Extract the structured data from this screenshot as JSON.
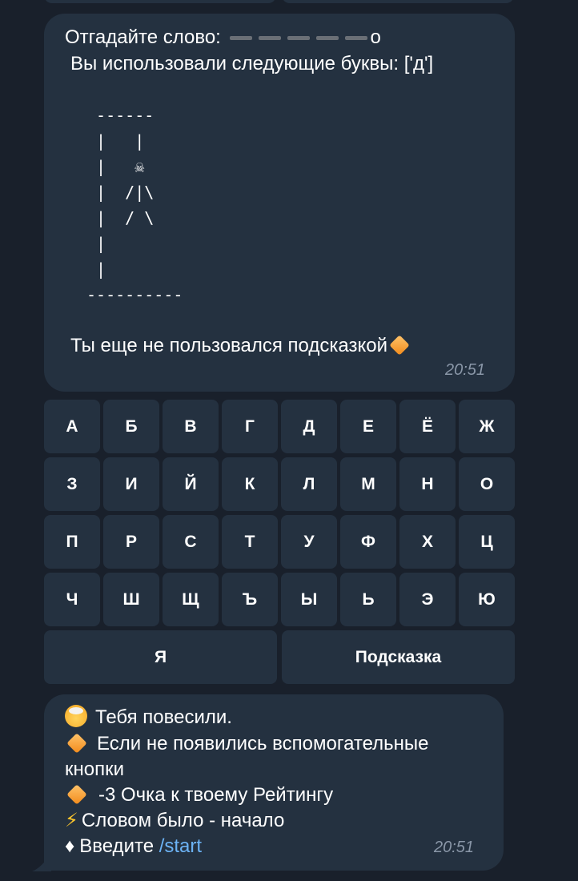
{
  "message1": {
    "guess_label": "Отгадайте слово:",
    "hidden_letters_count": 5,
    "revealed_letter": "о",
    "used_letters_line": "Вы использовали следующие буквы: ['д']",
    "hangman_art": " ------\n |   |\n |   ☠\n |  /|\\\n |  / \\\n |\n |\n----------",
    "hint_status": "Ты еще не пользовался подсказкой",
    "time": "20:51"
  },
  "keyboard": {
    "rows": [
      [
        "А",
        "Б",
        "В",
        "Г",
        "Д",
        "Е",
        "Ё",
        "Ж"
      ],
      [
        "З",
        "И",
        "Й",
        "К",
        "Л",
        "М",
        "Н",
        "О"
      ],
      [
        "П",
        "Р",
        "С",
        "Т",
        "У",
        "Ф",
        "Х",
        "Ц"
      ],
      [
        "Ч",
        "Ш",
        "Щ",
        "Ъ",
        "Ы",
        "Ь",
        "Э",
        "Ю"
      ]
    ],
    "last_row": [
      "Я",
      "Подсказка"
    ]
  },
  "message2": {
    "line1": "Тебя повесили.",
    "line2": "Если не появились вспомогательные",
    "line3": "кнопки",
    "line4": "-3 Очка к твоему Рейтингу",
    "line5_icon": "⚡",
    "line5": "Словом было - начало",
    "line6_icon": "♦",
    "line6_text": "Введите",
    "line6_link": "/start",
    "time": "20:51"
  },
  "colors": {
    "background": "#19202b",
    "bubble": "#243140",
    "timestamp": "#8a97a8",
    "link": "#6cb3f5",
    "hidden_dash": "#6a6f76"
  }
}
